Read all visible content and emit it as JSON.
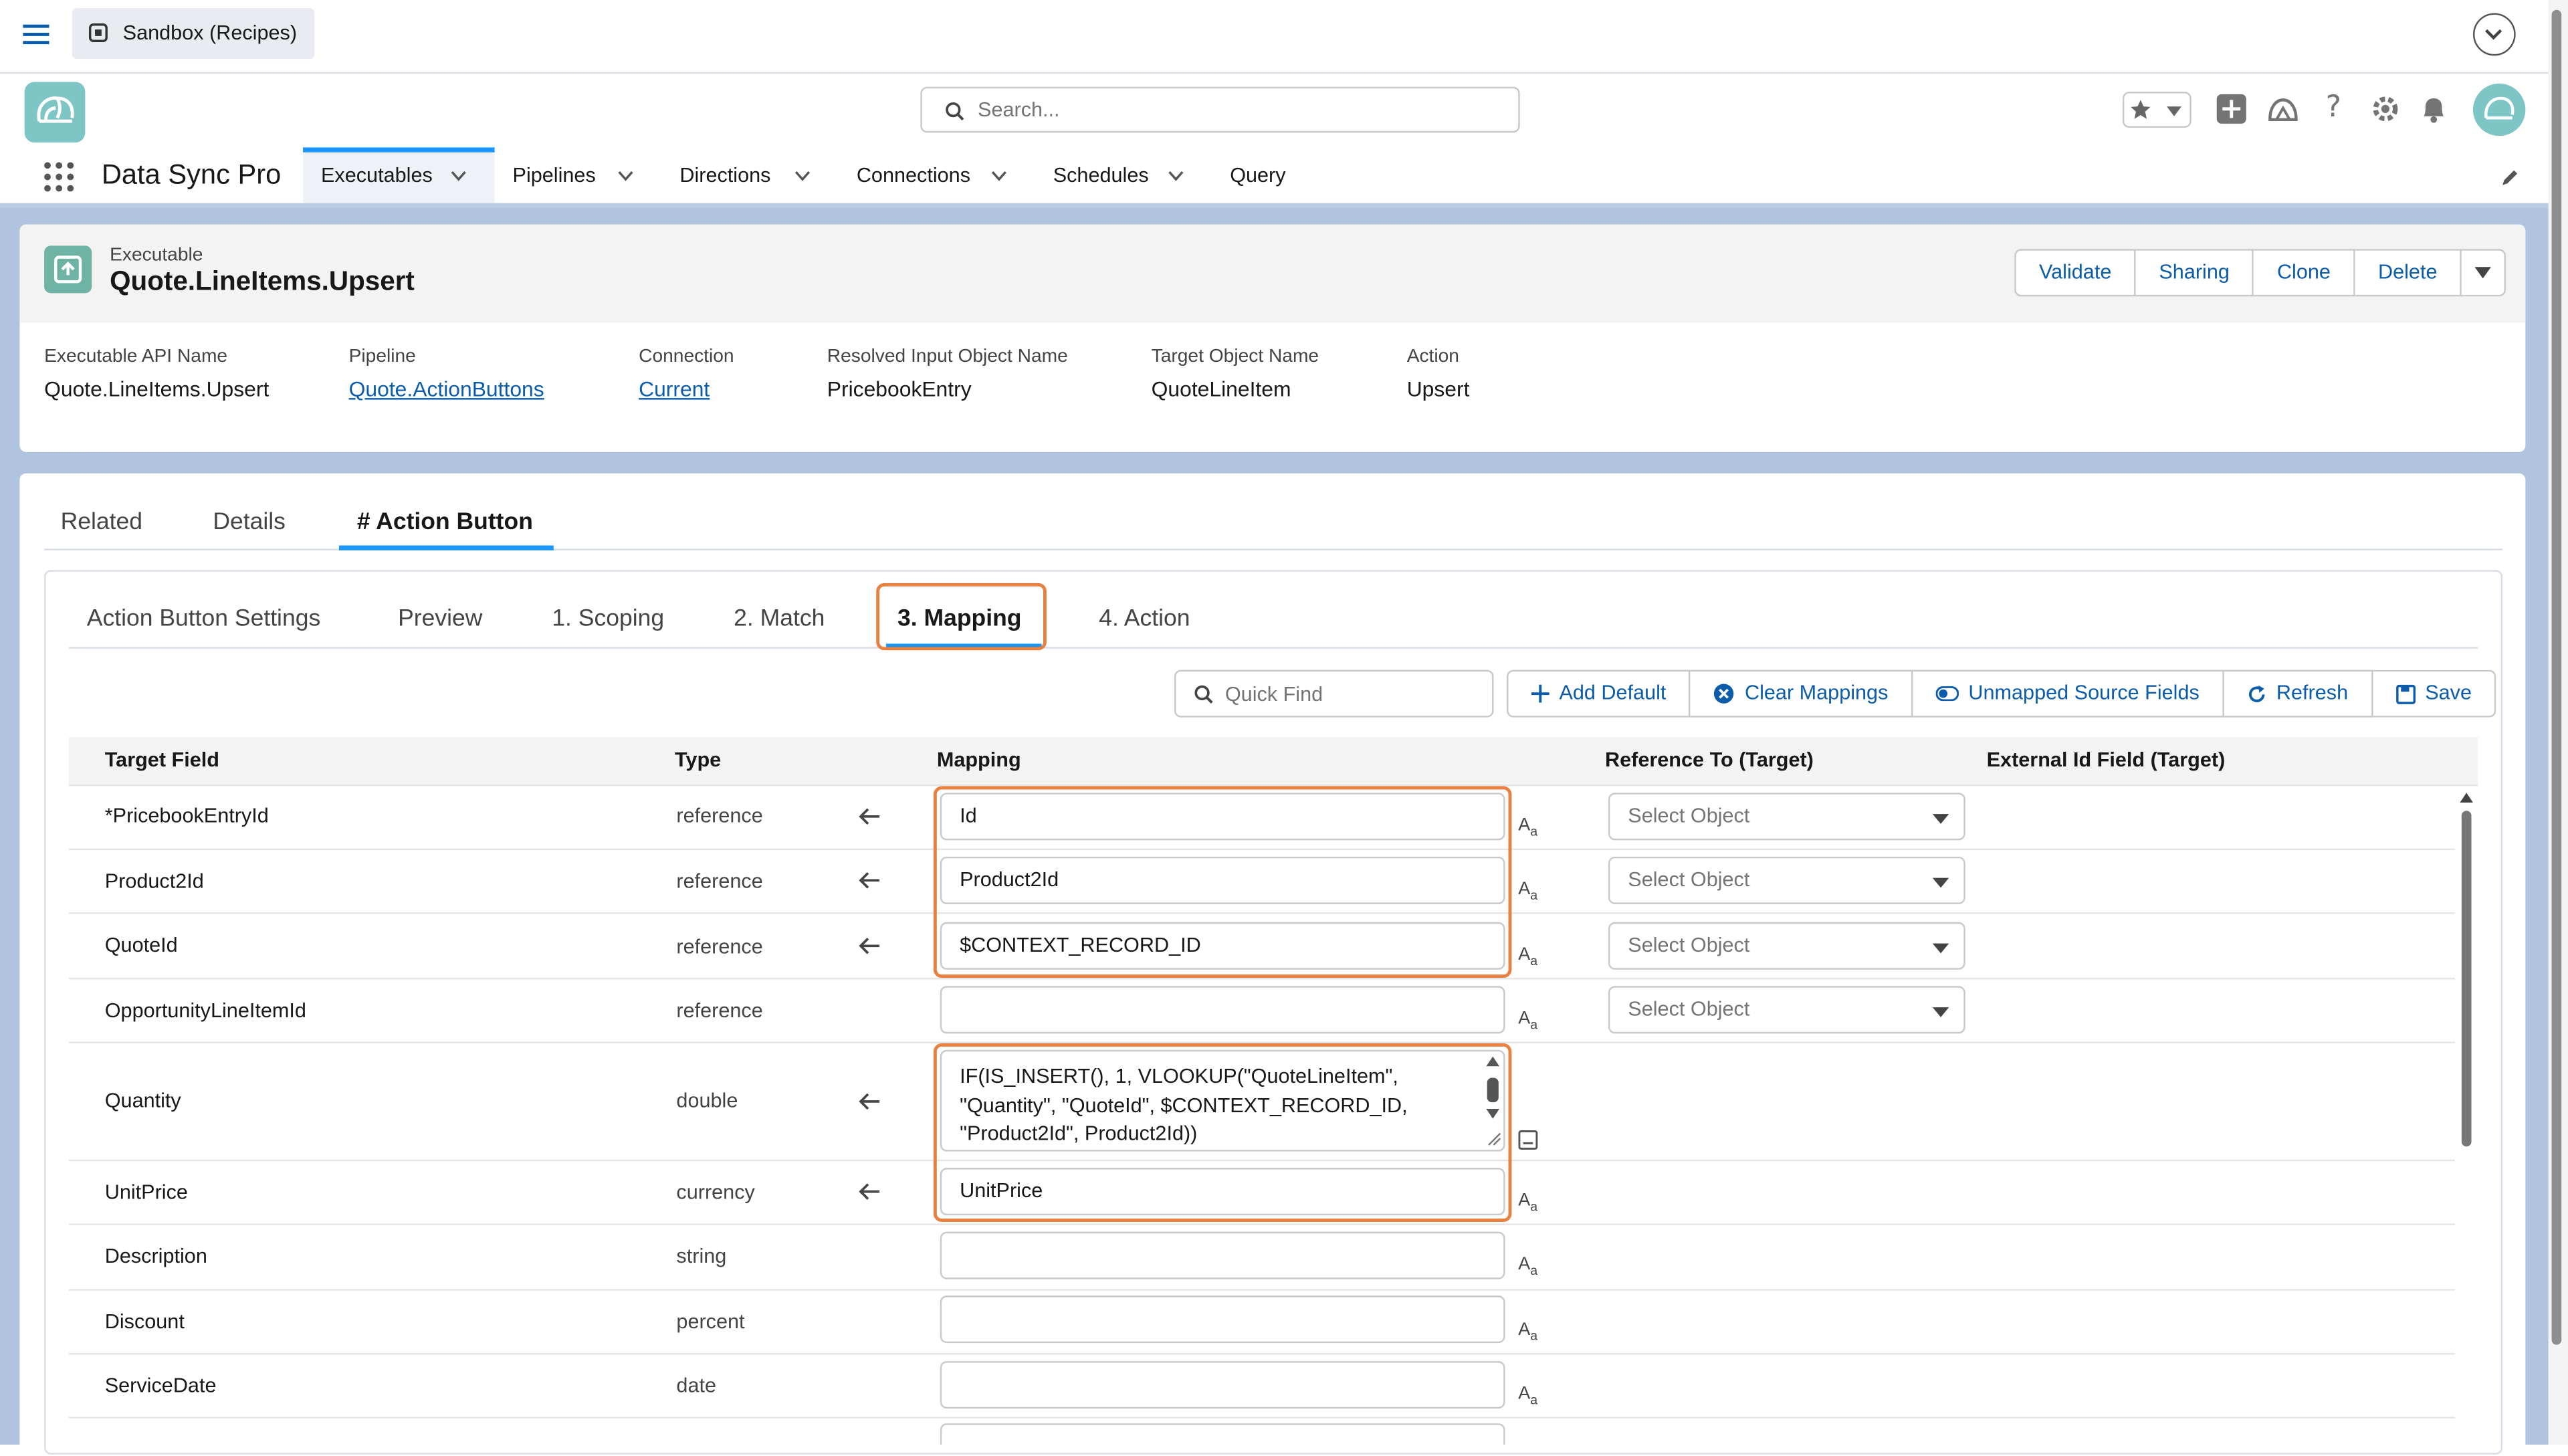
{
  "topbar": {
    "sandbox_label": "Sandbox (Recipes)"
  },
  "header": {
    "search_placeholder": "Search..."
  },
  "nav": {
    "app_name": "Data Sync Pro",
    "tabs": [
      {
        "label": "Executables",
        "has_menu": true
      },
      {
        "label": "Pipelines",
        "has_menu": true
      },
      {
        "label": "Directions",
        "has_menu": true
      },
      {
        "label": "Connections",
        "has_menu": true
      },
      {
        "label": "Schedules",
        "has_menu": true
      },
      {
        "label": "Query",
        "has_menu": false
      }
    ]
  },
  "record": {
    "type": "Executable",
    "title": "Quote.LineItems.Upsert",
    "actions": [
      "Validate",
      "Sharing",
      "Clone",
      "Delete"
    ],
    "fields": [
      {
        "label": "Executable API Name",
        "value": "Quote.LineItems.Upsert",
        "link": false
      },
      {
        "label": "Pipeline",
        "value": "Quote.ActionButtons",
        "link": true
      },
      {
        "label": "Connection",
        "value": "Current",
        "link": true
      },
      {
        "label": "Resolved Input Object Name",
        "value": "PricebookEntry",
        "link": false
      },
      {
        "label": "Target Object Name",
        "value": "QuoteLineItem",
        "link": false
      },
      {
        "label": "Action",
        "value": "Upsert",
        "link": false
      }
    ]
  },
  "tabs": [
    "Related",
    "Details",
    "# Action Button"
  ],
  "subtabs": [
    "Action Button Settings",
    "Preview",
    "1. Scoping",
    "2. Match",
    "3. Mapping",
    "4. Action"
  ],
  "toolbar": {
    "quick_find_placeholder": "Quick Find",
    "buttons": [
      "Add Default",
      "Clear Mappings",
      "Unmapped Source Fields",
      "Refresh",
      "Save"
    ]
  },
  "table": {
    "headers": [
      "Target Field",
      "Type",
      "Mapping",
      "Reference To (Target)",
      "External Id Field (Target)"
    ],
    "select_placeholder": "Select Object",
    "rows": [
      {
        "field": "*PricebookEntryId",
        "type": "reference",
        "mapping": "Id"
      },
      {
        "field": "Product2Id",
        "type": "reference",
        "mapping": "Product2Id"
      },
      {
        "field": "QuoteId",
        "type": "reference",
        "mapping": "$CONTEXT_RECORD_ID"
      },
      {
        "field": "OpportunityLineItemId",
        "type": "reference",
        "mapping": ""
      },
      {
        "field": "Quantity",
        "type": "double",
        "mapping": "IF(IS_INSERT(), 1, VLOOKUP(\"QuoteLineItem\", \"Quantity\", \"QuoteId\", $CONTEXT_RECORD_ID, \"Product2Id\", Product2Id))"
      },
      {
        "field": "UnitPrice",
        "type": "currency",
        "mapping": "UnitPrice"
      },
      {
        "field": "Description",
        "type": "string",
        "mapping": ""
      },
      {
        "field": "Discount",
        "type": "percent",
        "mapping": ""
      },
      {
        "field": "ServiceDate",
        "type": "date",
        "mapping": ""
      }
    ]
  },
  "colors": {
    "accent": "#0b5cab",
    "highlight": "#e8803f",
    "tab_underline": "#1b96ff"
  }
}
